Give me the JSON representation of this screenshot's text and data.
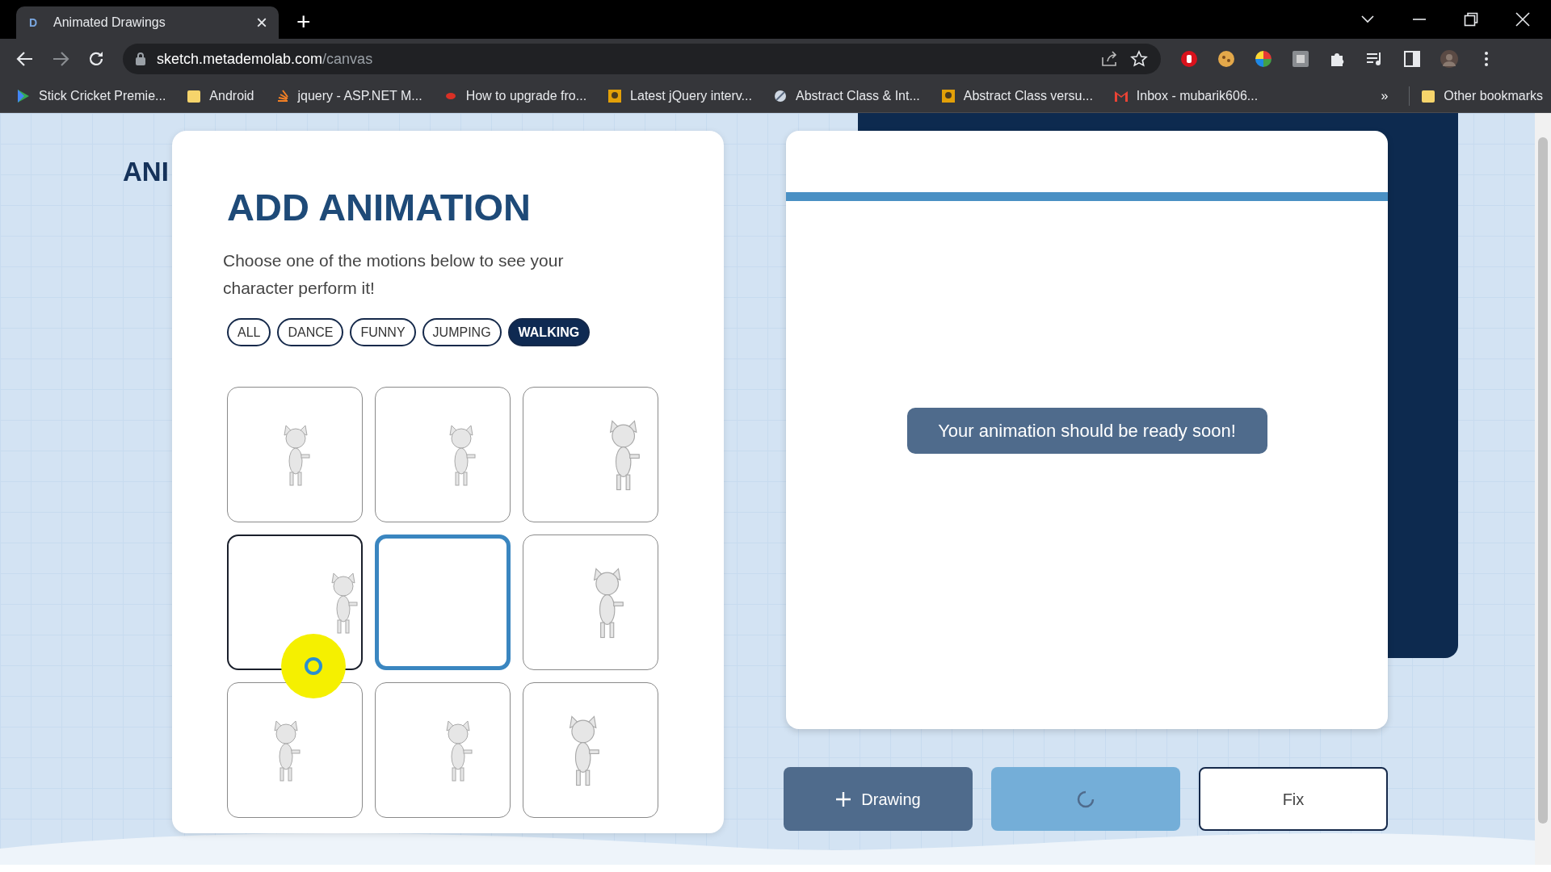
{
  "browser": {
    "tab": {
      "favicon": "D",
      "title": "Animated Drawings",
      "close": "×"
    },
    "new_tab": "+",
    "url": {
      "host": "sketch.metademolab.com",
      "path": "/canvas"
    },
    "bookmarks": [
      {
        "label": "Stick Cricket Premie..."
      },
      {
        "label": "Android"
      },
      {
        "label": "jquery - ASP.NET M..."
      },
      {
        "label": "How to upgrade fro..."
      },
      {
        "label": "Latest jQuery interv..."
      },
      {
        "label": "Abstract Class & Int..."
      },
      {
        "label": "Abstract Class versu..."
      },
      {
        "label": "Inbox - mubarik606..."
      }
    ],
    "more_bookmarks": "»",
    "other_bookmarks": "Other bookmarks"
  },
  "page": {
    "behind_title": "ANI",
    "card": {
      "title": "ADD ANIMATION",
      "description": "Choose one of the motions below to see your character perform it!",
      "filters": [
        {
          "label": "ALL",
          "selected": false
        },
        {
          "label": "DANCE",
          "selected": false
        },
        {
          "label": "FUNNY",
          "selected": false
        },
        {
          "label": "JUMPING",
          "selected": false
        },
        {
          "label": "WALKING",
          "selected": true
        }
      ],
      "motions": [
        {
          "kind": "picture",
          "selected": false,
          "hovered": false
        },
        {
          "kind": "picture",
          "selected": false,
          "hovered": false
        },
        {
          "kind": "picture",
          "selected": false,
          "hovered": false
        },
        {
          "kind": "picture",
          "selected": false,
          "hovered": true
        },
        {
          "kind": "empty",
          "selected": true,
          "hovered": false
        },
        {
          "kind": "picture",
          "selected": false,
          "hovered": false
        },
        {
          "kind": "picture",
          "selected": false,
          "hovered": false
        },
        {
          "kind": "picture",
          "selected": false,
          "hovered": false
        },
        {
          "kind": "picture",
          "selected": false,
          "hovered": false
        }
      ]
    },
    "preview": {
      "message": "Your animation should be ready soon!"
    },
    "actions": [
      {
        "kind": "add",
        "label": "Drawing"
      },
      {
        "kind": "loading"
      },
      {
        "kind": "outline",
        "label": "Fix"
      }
    ]
  }
}
